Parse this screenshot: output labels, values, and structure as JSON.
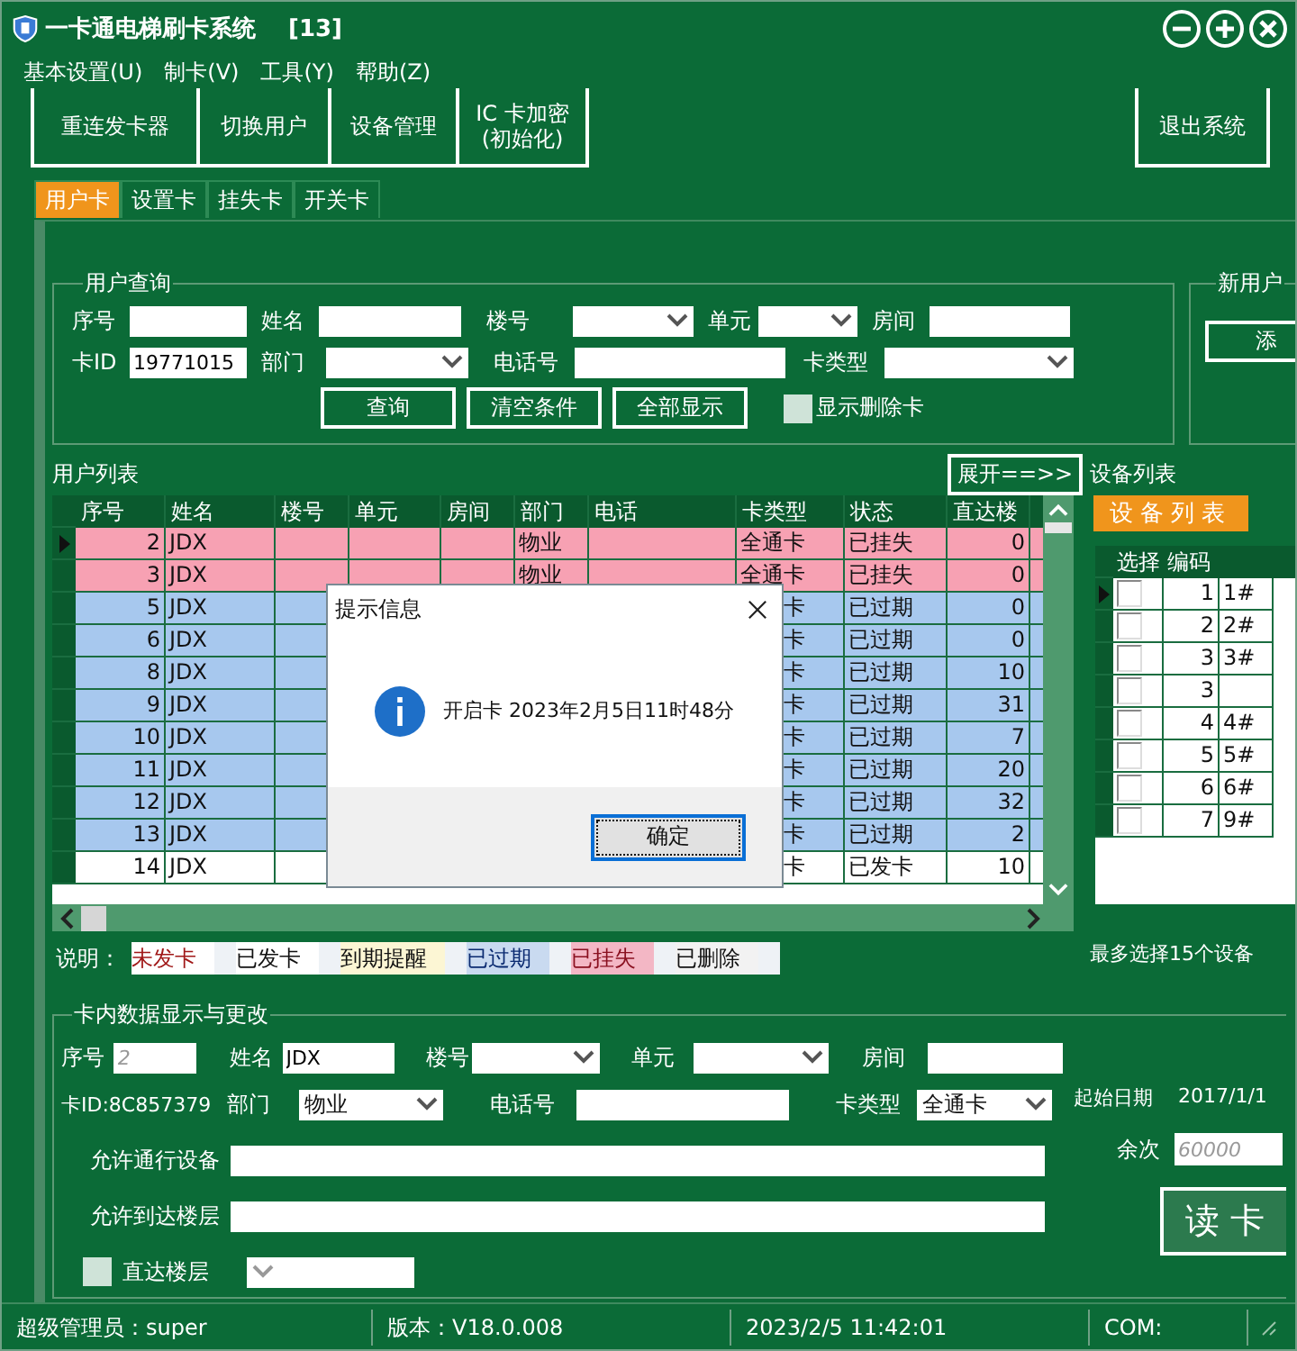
{
  "window": {
    "title": "一卡通电梯刷卡系统",
    "badge": "[13]"
  },
  "menu": [
    "基本设置(U)",
    "制卡(V)",
    "工具(Y)",
    "帮助(Z)"
  ],
  "toolbar": {
    "left": [
      {
        "lines": [
          "重连发卡器"
        ]
      },
      {
        "lines": [
          "切换用户"
        ]
      },
      {
        "lines": [
          "设备管理"
        ]
      },
      {
        "lines": [
          "IC 卡加密",
          "(初始化)"
        ]
      }
    ],
    "right": [
      {
        "lines": [
          "退出系统"
        ]
      }
    ]
  },
  "tabs": [
    {
      "label": "用户卡",
      "selected": true
    },
    {
      "label": "设置卡",
      "selected": false
    },
    {
      "label": "挂失卡",
      "selected": false
    },
    {
      "label": "开关卡",
      "selected": false
    }
  ],
  "query": {
    "title": "用户查询",
    "rows": [
      [
        {
          "label": "序号",
          "kind": "text"
        },
        {
          "label": "姓名",
          "kind": "text"
        },
        {
          "label": "楼号",
          "kind": "select"
        },
        {
          "label": "单元",
          "kind": "select"
        },
        {
          "label": "房间",
          "kind": "text"
        }
      ],
      [
        {
          "label": "卡ID",
          "kind": "text",
          "value": "19771015"
        },
        {
          "label": "部门",
          "kind": "select"
        },
        {
          "label": "电话号",
          "kind": "text"
        },
        {
          "label": "卡类型",
          "kind": "select"
        }
      ]
    ],
    "buttons": [
      "查询",
      "清空条件",
      "全部显示"
    ],
    "checkbox": {
      "label": "显示删除卡",
      "checked": false
    }
  },
  "new_user": {
    "title": "新用户",
    "button": "添"
  },
  "user_list": {
    "title": "用户列表",
    "expand_button": "展开==>>",
    "columns": [
      "序号",
      "姓名",
      "楼号",
      "单元",
      "房间",
      "部门",
      "电话",
      "卡类型",
      "状态",
      "直达楼"
    ],
    "rows": [
      {
        "current": true,
        "covered": false,
        "kind": "lost",
        "cells": {
          "no": "2",
          "name": "JDX",
          "dept": "物业",
          "type": "全通卡",
          "status": "已挂失",
          "direct": "0"
        }
      },
      {
        "current": false,
        "covered": false,
        "kind": "lost",
        "cells": {
          "no": "3",
          "name": "JDX",
          "dept": "物业",
          "type": "全通卡",
          "status": "已挂失",
          "direct": "0"
        }
      },
      {
        "current": false,
        "covered": true,
        "kind": "expired",
        "cells": {
          "no": "5",
          "name": "JDX",
          "type": "卡",
          "status": "已过期",
          "direct": "0"
        }
      },
      {
        "current": false,
        "covered": true,
        "kind": "expired",
        "cells": {
          "no": "6",
          "name": "JDX",
          "type": "卡",
          "status": "已过期",
          "direct": "0"
        }
      },
      {
        "current": false,
        "covered": true,
        "kind": "expired",
        "cells": {
          "no": "8",
          "name": "JDX",
          "type": "卡",
          "status": "已过期",
          "direct": "10"
        }
      },
      {
        "current": false,
        "covered": true,
        "kind": "expired",
        "cells": {
          "no": "9",
          "name": "JDX",
          "type": "卡",
          "status": "已过期",
          "direct": "31"
        }
      },
      {
        "current": false,
        "covered": true,
        "kind": "expired",
        "cells": {
          "no": "10",
          "name": "JDX",
          "type": "卡",
          "status": "已过期",
          "direct": "7"
        }
      },
      {
        "current": false,
        "covered": true,
        "kind": "expired",
        "cells": {
          "no": "11",
          "name": "JDX",
          "type": "卡",
          "status": "已过期",
          "direct": "20"
        }
      },
      {
        "current": false,
        "covered": true,
        "kind": "expired",
        "cells": {
          "no": "12",
          "name": "JDX",
          "type": "卡",
          "status": "已过期",
          "direct": "32"
        }
      },
      {
        "current": false,
        "covered": true,
        "kind": "expired",
        "cells": {
          "no": "13",
          "name": "JDX",
          "type": "卡",
          "status": "已过期",
          "direct": "2"
        }
      },
      {
        "current": false,
        "covered": true,
        "kind": "issued",
        "cells": {
          "no": "14",
          "name": "JDX",
          "type": "卡",
          "status": "已发卡",
          "direct": "10"
        }
      }
    ]
  },
  "device_list": {
    "title": "设备列表",
    "tab": "设备列表",
    "columns": [
      "选择",
      "编码"
    ],
    "rows": [
      {
        "current": true,
        "checked": false,
        "code": "1",
        "name": "1#"
      },
      {
        "current": false,
        "checked": false,
        "code": "2",
        "name": "2#"
      },
      {
        "current": false,
        "checked": false,
        "code": "3",
        "name": "3#"
      },
      {
        "current": false,
        "checked": false,
        "code": "3"
      },
      {
        "current": false,
        "checked": false,
        "code": "4",
        "name": "4#"
      },
      {
        "current": false,
        "checked": false,
        "code": "5",
        "name": "5#"
      },
      {
        "current": false,
        "checked": false,
        "code": "6",
        "name": "6#"
      },
      {
        "current": false,
        "checked": false,
        "code": "7",
        "name": "9#"
      }
    ]
  },
  "legend": {
    "label": "说明：",
    "items": [
      {
        "text": "未发卡",
        "kind": "unissued"
      },
      {
        "text": "已发卡",
        "kind": "issued"
      },
      {
        "text": "到期提醒",
        "kind": "due"
      },
      {
        "text": "已过期",
        "kind": "expired"
      },
      {
        "text": "已挂失",
        "kind": "lost"
      },
      {
        "text": "已删除",
        "kind": "deleted"
      }
    ]
  },
  "max_note": "最多选择15个设备",
  "card_data": {
    "title": "卡内数据显示与更改",
    "row1": [
      {
        "label": "序号",
        "kind": "text",
        "value": "2",
        "disabled": true
      },
      {
        "label": "姓名",
        "kind": "text",
        "value": "JDX"
      },
      {
        "label": "楼号",
        "kind": "select"
      },
      {
        "label": "单元",
        "kind": "select"
      },
      {
        "label": "房间",
        "kind": "text"
      }
    ],
    "card_id": "卡ID:8C857379",
    "row2": [
      {
        "label": "部门",
        "kind": "select",
        "value": "物业"
      },
      {
        "label": "电话号",
        "kind": "text"
      },
      {
        "label": "卡类型",
        "kind": "select",
        "value": "全通卡"
      }
    ],
    "start_date": {
      "label": "起始日期",
      "value": "2017/1/1"
    },
    "devices": {
      "label": "允许通行设备"
    },
    "floors": {
      "label": "允许到达楼层"
    },
    "direct_floor": {
      "label": "直达楼层",
      "checked": false
    },
    "remaining": {
      "label": "余次",
      "value": "60000",
      "disabled": true
    },
    "read_button": "读 卡"
  },
  "status_bar": [
    "超级管理员：super",
    "版本：V18.0.008",
    "2023/2/5 11:42:01",
    "COM:"
  ],
  "dialog": {
    "title": "提示信息",
    "message": "开启卡 2023年2月5日11时48分",
    "button": "确定"
  }
}
